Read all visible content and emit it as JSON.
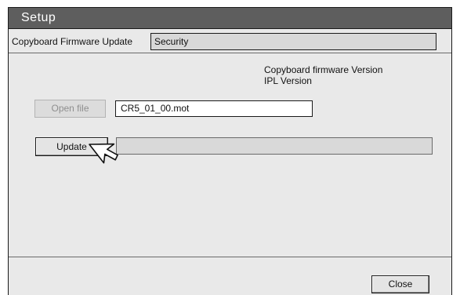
{
  "window": {
    "title": "Setup"
  },
  "tabs": [
    {
      "label": "Copyboard Firmware Update",
      "active": true
    },
    {
      "label": "Security",
      "active": false
    }
  ],
  "info": {
    "firmware_version_label": "Copyboard firmware Version",
    "ipl_version_label": "IPL Version"
  },
  "file": {
    "open_button_label": "Open file",
    "filename": "CR5_01_00.mot"
  },
  "update": {
    "button_label": "Update",
    "progress": 0
  },
  "footer": {
    "close_label": "Close"
  },
  "cursor_icon": "arrow-pointer-icon"
}
